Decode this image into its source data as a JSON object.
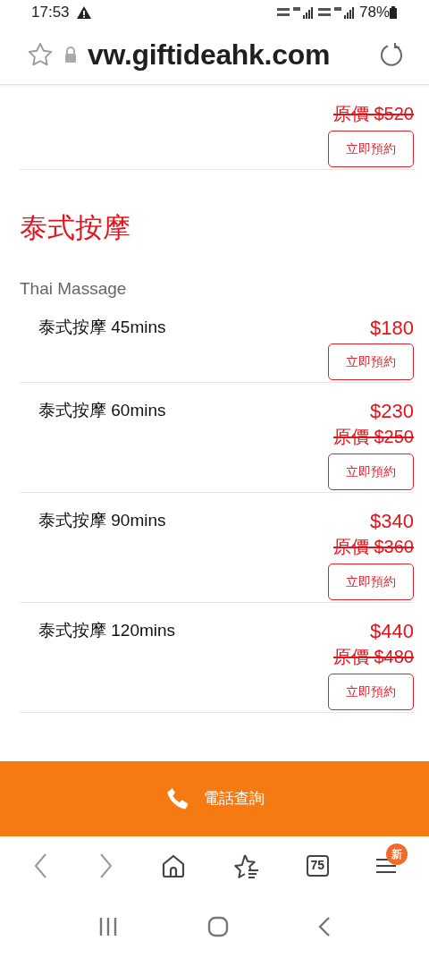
{
  "status_bar": {
    "time": "17:53",
    "battery": "78%"
  },
  "address_bar": {
    "url": "vw.giftideahk.com"
  },
  "content": [
    {
      "kind": "item",
      "original_price": "原價 $520",
      "button": "立即預約"
    },
    {
      "kind": "heading",
      "title": "泰式按摩",
      "subtitle": "Thai Massage"
    },
    {
      "kind": "item",
      "name": "泰式按摩 45mins",
      "price": "$180",
      "button": "立即預約"
    },
    {
      "kind": "item",
      "name": "泰式按摩 60mins",
      "price": "$230",
      "original_price": "原價 $250",
      "button": "立即預約"
    },
    {
      "kind": "item",
      "name": "泰式按摩 90mins",
      "price": "$340",
      "original_price": "原價 $360",
      "button": "立即預約"
    },
    {
      "kind": "item",
      "name": "泰式按摩 120mins",
      "price": "$440",
      "original_price": "原價 $480",
      "button": "立即預約"
    }
  ],
  "call_bar": {
    "label": "電話查詢"
  },
  "browser_nav": {
    "tab_count": "75",
    "badge": "新"
  }
}
